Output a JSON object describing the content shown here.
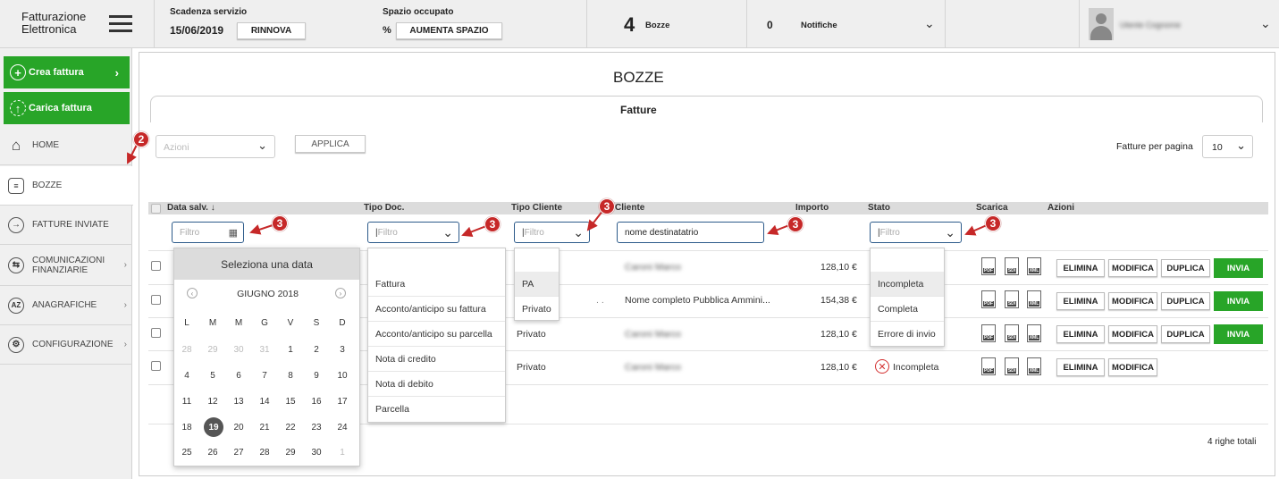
{
  "brand": {
    "line1": "Fatturazione",
    "line2": "Elettronica"
  },
  "topbar": {
    "scadenza_label": "Scadenza servizio",
    "scadenza_date": "15/06/2019",
    "rinnova": "RINNOVA",
    "spazio_label": "Spazio occupato",
    "spazio_value": "%",
    "aumenta": "AUMENTA SPAZIO",
    "bozze_count": "4",
    "bozze_label": "Bozze",
    "notifiche_count": "0",
    "notifiche_label": "Notifiche",
    "user_name": "Utente Cognome"
  },
  "sidebar": {
    "crea": "Crea fattura",
    "carica": "Carica fattura",
    "items": [
      {
        "label": "HOME"
      },
      {
        "label": "BOZZE"
      },
      {
        "label": "FATTURE INVIATE"
      },
      {
        "label1": "COMUNICAZIONI",
        "label2": "FINANZIARIE"
      },
      {
        "label": "ANAGRAFICHE"
      },
      {
        "label": "CONFIGURAZIONE"
      }
    ]
  },
  "main": {
    "title": "BOZZE",
    "tab": "Fatture",
    "azioni_placeholder": "Azioni",
    "applica": "APPLICA",
    "per_page_label": "Fatture per pagina",
    "per_page_value": "10",
    "columns": [
      "Data salv.",
      "Tipo Doc.",
      "Tipo Cliente",
      "Cliente",
      "Importo",
      "Stato",
      "Scarica",
      "Azioni"
    ],
    "filter_placeholder": "Filtro",
    "cliente_filter_value": "nome destinatatrio",
    "rows": [
      {
        "tipo_cliente": "",
        "cliente": "Caroni Marco",
        "importo": "128,10 €",
        "stato": ""
      },
      {
        "tipo_cliente": ". .",
        "cliente": "Nome completo Pubblica Ammini...",
        "importo": "154,38 €",
        "stato": ""
      },
      {
        "tipo_cliente": "Privato",
        "cliente": "Caroni Marco",
        "importo": "128,10 €",
        "stato": ""
      },
      {
        "tipo_cliente": "Privato",
        "cliente": "Caroni Marco",
        "importo": "128,10 €",
        "stato": "Incompleta"
      }
    ],
    "btn_elimina": "ELIMINA",
    "btn_modifica": "MODIFICA",
    "btn_duplica": "DUPLICA",
    "btn_invia": "INVIA",
    "doc_pdf": "PDF",
    "doc_sdi": "SDI",
    "doc_xml": "XML",
    "totale": "4 righe totali"
  },
  "dropdowns": {
    "tipo_doc": [
      "Fattura",
      "Acconto/anticipo su fattura",
      "Acconto/anticipo su parcella",
      "Nota di credito",
      "Nota di debito",
      "Parcella"
    ],
    "tipo_cliente": [
      "PA",
      "Privato"
    ],
    "stato": [
      "Incompleta",
      "Completa",
      "Errore di invio"
    ]
  },
  "calendar": {
    "title": "Seleziona una data",
    "month": "GIUGNO 2018",
    "weekdays": [
      "L",
      "M",
      "M",
      "G",
      "V",
      "S",
      "D"
    ],
    "selected": "19",
    "weeks": [
      [
        "28",
        "29",
        "30",
        "31",
        "1",
        "2",
        "3"
      ],
      [
        "4",
        "5",
        "6",
        "7",
        "8",
        "9",
        "10"
      ],
      [
        "11",
        "12",
        "13",
        "14",
        "15",
        "16",
        "17"
      ],
      [
        "18",
        "19",
        "20",
        "21",
        "22",
        "23",
        "24"
      ],
      [
        "25",
        "26",
        "27",
        "28",
        "29",
        "30",
        "1"
      ]
    ]
  },
  "callouts": {
    "two": "2",
    "three": "3"
  },
  "colors": {
    "green": "#28a528",
    "callout_red": "#c62828",
    "filter_border": "#2c5a8a"
  }
}
